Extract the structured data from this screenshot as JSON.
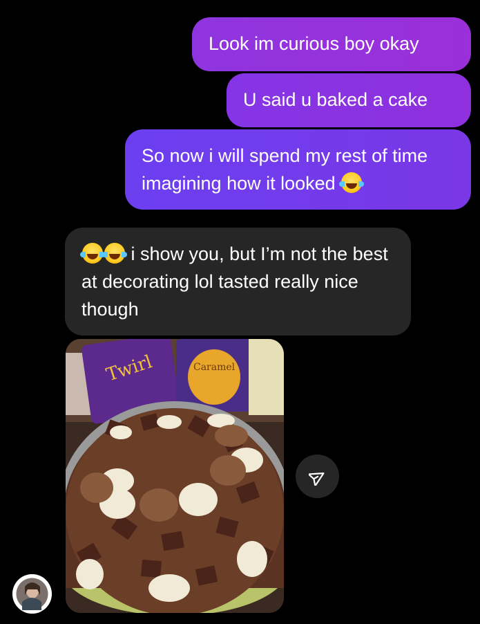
{
  "messages": [
    {
      "direction": "outgoing",
      "text": "Look im curious boy okay"
    },
    {
      "direction": "outgoing",
      "text": "U said u baked a cake"
    },
    {
      "direction": "outgoing",
      "text": "So now i will spend my rest of time imagining how it looked",
      "emoji": [
        "face-with-tears-of-joy"
      ]
    },
    {
      "direction": "incoming",
      "text": " i show you, but I’m not the best at decorating lol tasted really nice though",
      "emoji": [
        "face-with-tears-of-joy",
        "face-with-tears-of-joy"
      ]
    }
  ],
  "photo": {
    "subject": "chocolate cake decorated with chocolate chunks and white and milk chocolate buttons"
  },
  "icons": {
    "share": "paper-plane-share-icon",
    "avatar": "contact-avatar"
  },
  "colors": {
    "background": "#000000",
    "incoming_bubble": "#262626",
    "outgoing_top": "#9b2fd9",
    "outgoing_bottom": "#6b3ff0"
  }
}
